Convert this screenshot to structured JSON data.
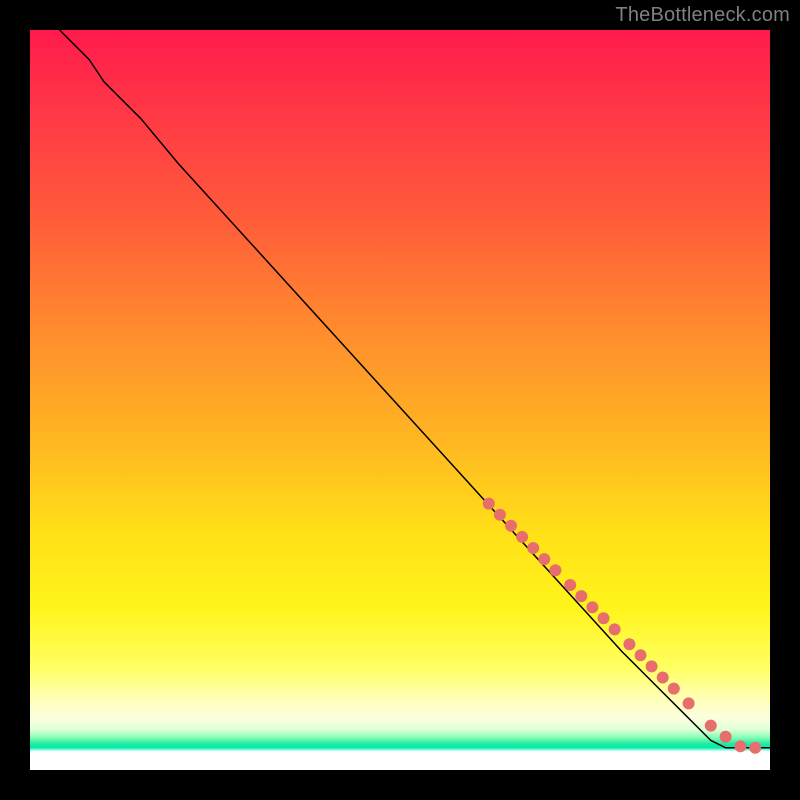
{
  "watermark": "TheBottleneck.com",
  "chart_data": {
    "type": "line",
    "title": "",
    "xlabel": "",
    "ylabel": "",
    "xlim": [
      0,
      100
    ],
    "ylim": [
      0,
      100
    ],
    "grid": false,
    "legend": false,
    "background_gradient": {
      "direction": "vertical",
      "stops": [
        {
          "pos": 0.0,
          "color": "#ff1a4d"
        },
        {
          "pos": 0.25,
          "color": "#ff5a3a"
        },
        {
          "pos": 0.55,
          "color": "#ffb522"
        },
        {
          "pos": 0.78,
          "color": "#fff41a"
        },
        {
          "pos": 0.93,
          "color": "#fbffe0"
        },
        {
          "pos": 0.965,
          "color": "#20e8a0"
        },
        {
          "pos": 1.0,
          "color": "#ffffff"
        }
      ]
    },
    "series": [
      {
        "name": "curve",
        "kind": "line",
        "color": "#000000",
        "x": [
          4,
          6,
          8,
          10,
          15,
          20,
          30,
          40,
          50,
          60,
          70,
          80,
          85,
          88,
          90,
          92,
          94,
          96,
          100
        ],
        "y": [
          100,
          98,
          96,
          93,
          88,
          82,
          71,
          60,
          49,
          38,
          27,
          16,
          11,
          8,
          6,
          4,
          3,
          3,
          3
        ]
      },
      {
        "name": "points",
        "kind": "scatter",
        "color": "#e86d6d",
        "marker_radius": 6,
        "x": [
          62,
          63.5,
          65,
          66.5,
          68,
          69.5,
          71,
          73,
          74.5,
          76,
          77.5,
          79,
          81,
          82.5,
          84,
          85.5,
          87,
          89,
          92,
          94,
          96,
          98
        ],
        "y": [
          36,
          34.5,
          33,
          31.5,
          30,
          28.5,
          27,
          25,
          23.5,
          22,
          20.5,
          19,
          17,
          15.5,
          14,
          12.5,
          11,
          9,
          6,
          4.5,
          3.2,
          3
        ]
      }
    ]
  }
}
